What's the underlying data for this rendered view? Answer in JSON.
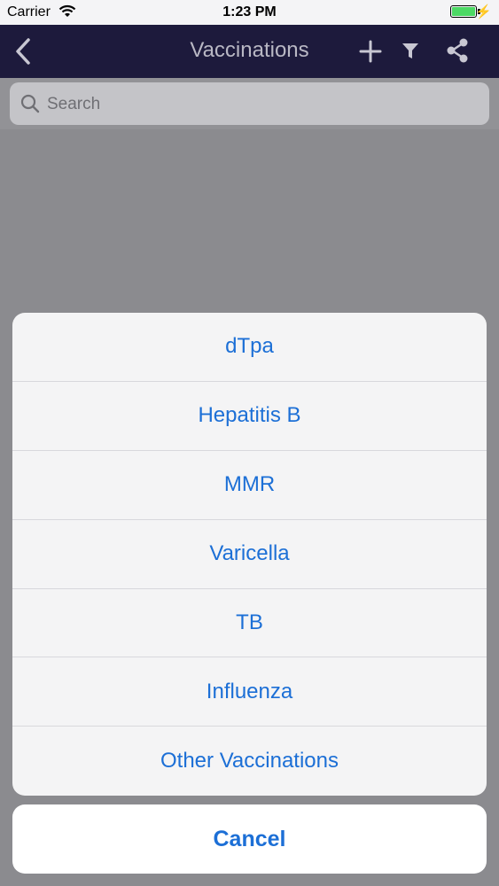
{
  "status_bar": {
    "carrier": "Carrier",
    "time": "1:23 PM",
    "battery_level": 1.0,
    "charge_glyph": "⚡"
  },
  "nav": {
    "title": "Vaccinations",
    "icons": [
      "back-chevron-icon",
      "plus-icon",
      "filter-icon",
      "share-icon"
    ]
  },
  "search": {
    "placeholder": "Search",
    "value": ""
  },
  "action_sheet": {
    "options": [
      "dTpa",
      "Hepatitis B",
      "MMR",
      "Varicella",
      "TB",
      "Influenza",
      "Other Vaccinations"
    ],
    "cancel_label": "Cancel"
  },
  "colors": {
    "accent": "#1c6fd6",
    "navbar": "#1d1a3c",
    "battery": "#4cd964"
  }
}
